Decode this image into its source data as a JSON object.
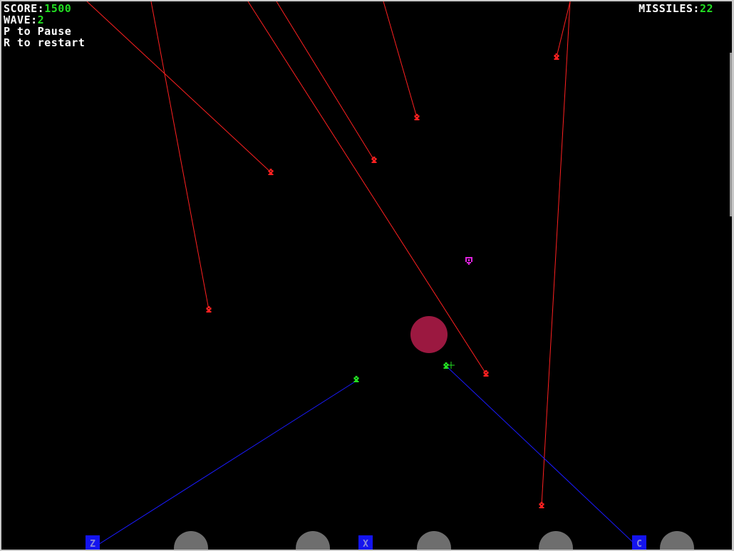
{
  "hud": {
    "score_label": "SCORE:",
    "score_value": "1500",
    "wave_label": "WAVE:",
    "wave_value": "2",
    "pause_hint": "P to Pause",
    "restart_hint": "R to restart",
    "missiles_label": "MISSILES:",
    "missiles_value": "22"
  },
  "launchers": [
    {
      "key": "Z"
    },
    {
      "key": "X"
    },
    {
      "key": "C"
    }
  ],
  "colors": {
    "background": "#000000",
    "hud_text": "#ffffff",
    "hud_value": "#22dd22",
    "enemy_missile": "#ff2020",
    "player_missile": "#1a1aff",
    "player_warhead": "#22dd22",
    "explosion": "#9b1840",
    "powerup": "#dd22dd",
    "launcher": "#1414ee",
    "city": "#6e6e6e"
  },
  "icons": {
    "enemy_warhead": "bug-icon",
    "player_warhead": "bug-icon",
    "powerup": "shield-icon",
    "cursor": "crosshair-icon"
  }
}
